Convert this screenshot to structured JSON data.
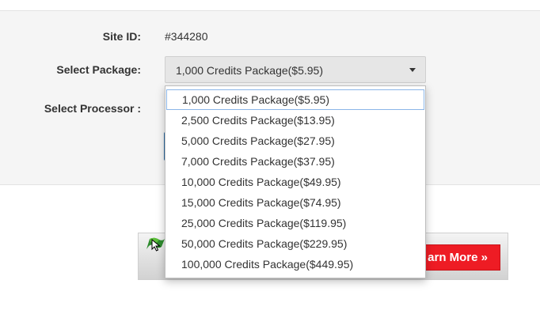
{
  "form": {
    "site_id_label": "Site ID:",
    "site_id_value": "#344280",
    "package_label": "Select Package:",
    "processor_label": "Select Processor :",
    "package_select": {
      "selected": "1,000 Credits Package($5.95)",
      "caret_icon": "caret-down-icon",
      "options": [
        "1,000 Credits Package($5.95)",
        "2,500 Credits Package($13.95)",
        "5,000 Credits Package($27.95)",
        "7,000 Credits Package($37.95)",
        "10,000 Credits Package($49.95)",
        "15,000 Credits Package($74.95)",
        "25,000 Credits Package($119.95)",
        "50,000 Credits Package($229.95)",
        "100,000 Credits Package($449.95)"
      ],
      "highlighted_index": 0
    }
  },
  "banner": {
    "button_label": "arn More »",
    "button_color": "#ee1c24",
    "logo_icon": "green-flag-logo-icon"
  },
  "colors": {
    "panel_bg": "#f5f5f5",
    "select_bg": "#e6e6e6",
    "highlight_border": "#8bb6e8"
  }
}
